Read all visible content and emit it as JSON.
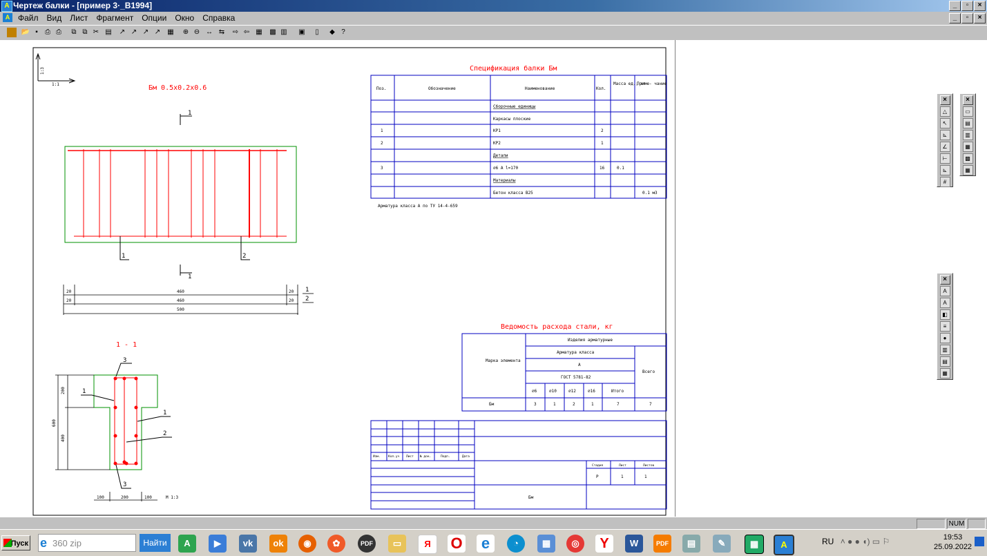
{
  "window": {
    "title": "Чертеж балки - [пример 3·_B1994]"
  },
  "menu": [
    "Файл",
    "Вид",
    "Лист",
    "Фрагмент",
    "Опции",
    "Окно",
    "Справка"
  ],
  "drawing": {
    "scale_axis_v": "1:3",
    "scale_axis_h": "1:1",
    "beam_title": "Бм 0.5x0.2x0.6",
    "section_title": "1 - 1",
    "section_mark": "1",
    "bar_label_1": "1",
    "bar_label_2": "2",
    "bar_label_3": "3",
    "dim_20": "20",
    "dim_460": "460",
    "dim_500": "500",
    "dim_200v": "200",
    "dim_400v": "400",
    "dim_600v": "600",
    "dim_100": "100",
    "dim_200h": "200",
    "scale_text": "М 1:3"
  },
  "spec": {
    "title": "Спецификация балки Бм",
    "headers": [
      "Поз.",
      "Обозначение",
      "Наименование",
      "Кол.",
      "Масса ед., кг",
      "Приме- чание"
    ],
    "rows": [
      [
        "",
        "",
        "Сборочные единицы",
        "",
        "",
        ""
      ],
      [
        "",
        "",
        "Каркасы плоские",
        "",
        "",
        ""
      ],
      [
        "1",
        "",
        "КР1",
        "2",
        "",
        ""
      ],
      [
        "2",
        "",
        "КР2",
        "1",
        "",
        ""
      ],
      [
        "",
        "",
        "Детали",
        "",
        "",
        ""
      ],
      [
        "3",
        "",
        "⌀6 А l=170",
        "16",
        "0.1",
        ""
      ],
      [
        "",
        "",
        "Материалы",
        "",
        "",
        ""
      ],
      [
        "",
        "",
        "Бетон класса В25",
        "",
        "",
        "0.1 м3"
      ]
    ],
    "note": "Арматура класса А по ТУ 14-4-659"
  },
  "steel": {
    "title": "Ведомость расхода стали, кг",
    "h_marka": "Марка элемента",
    "h_izd": "Изделия арматурные",
    "h_arm": "Арматура класса",
    "h_a": "А",
    "h_gost": "ГОСТ 5781-82",
    "h_total": "Всего",
    "cols": [
      "⌀6",
      "⌀10",
      "⌀12",
      "⌀16",
      "Итого"
    ],
    "row": {
      "mark": "Бм",
      "values": [
        "3",
        "1",
        "2",
        "1",
        "7"
      ],
      "total": "7"
    }
  },
  "titleblock": {
    "cols": [
      "Изм.",
      "Кол.уч",
      "Лист",
      "№ док.",
      "Подп.",
      "Дата"
    ],
    "stage_h": "Стадия",
    "sheet_h": "Лист",
    "sheets_h": "Листов",
    "stage": "Р",
    "sheet": "1",
    "sheets": "1",
    "name": "Бм"
  },
  "status": {
    "num": "NUM"
  },
  "taskbar": {
    "start": "Пуск",
    "search_placeholder": "360 zip",
    "find": "Найти",
    "lang": "RU",
    "time": "19:53",
    "date": "25.09.2022"
  },
  "colors": {
    "red": "#ff0000",
    "blue": "#0000c0",
    "green": "#009000",
    "titlebar": "#0a246a"
  }
}
